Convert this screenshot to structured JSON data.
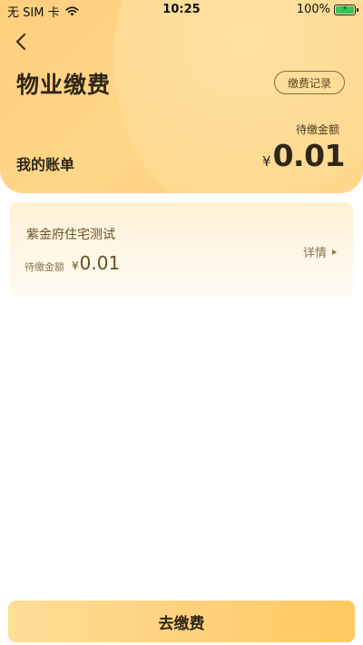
{
  "status_bar": {
    "carrier": "无 SIM 卡",
    "time": "10:25",
    "battery": "100%"
  },
  "header": {
    "title": "物业缴费",
    "records_label": "缴费记录",
    "my_bill_label": "我的账单",
    "due_label": "待缴金额",
    "currency": "¥",
    "due_amount": "0.01"
  },
  "property": {
    "name": "紫金府住宅测试",
    "due_label": "待缴金额",
    "currency": "¥",
    "amount": "0.01",
    "detail_label": "详情"
  },
  "footer": {
    "pay_label": "去缴费"
  },
  "colors": {
    "header_gradient": "#ffd68a",
    "accent": "#ffc95f",
    "card_background": "#fff3dc",
    "text_dark": "#2f2616",
    "text_brown": "#6a4f22"
  },
  "icons": {
    "back": "chevron-left-icon",
    "wifi": "wifi-icon",
    "battery": "battery-icon",
    "detail": "triangle-right-icon"
  }
}
